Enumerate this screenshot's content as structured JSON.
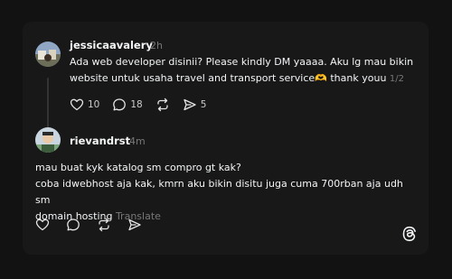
{
  "post": {
    "username": "jessicaavalery",
    "time": "2h",
    "text_line1": "Ada web developer disinii? Please kindly DM yaaaa. Aku lg mau bikin",
    "text_line2": "website untuk usaha travel and transport service🫶 thank youu",
    "page_indicator": "1/2",
    "like_count": "10",
    "reply_count": "18",
    "share_count": "5"
  },
  "reply": {
    "username": "rievandrst",
    "time": "4m",
    "line1": "mau buat kyk katalog sm compro gt kak?",
    "line2": "coba idwebhost aja kak, kmrn aku bikin disitu juga cuma 700rban aja udh sm",
    "line3": "domain hosting",
    "translate": "Translate"
  },
  "icons": {
    "like": "heart-icon",
    "reply": "comment-icon",
    "repost": "repost-icon",
    "share": "send-icon",
    "brand": "threads-logo-icon"
  }
}
